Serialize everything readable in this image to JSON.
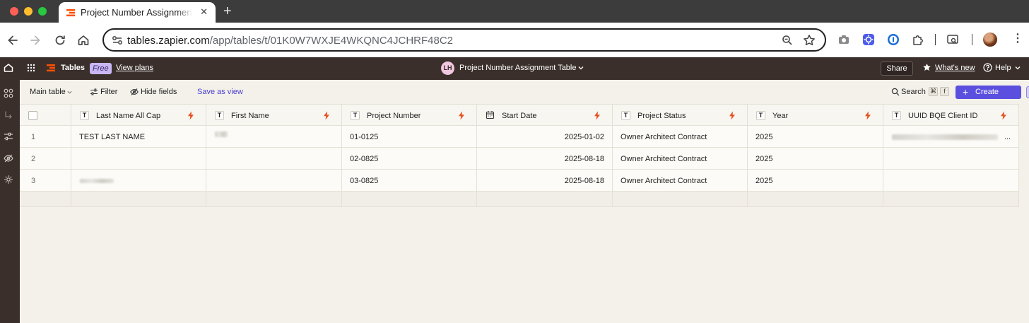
{
  "browser": {
    "tab_title": "Project Number Assignment Table",
    "url_host": "tables.zapier.com",
    "url_path": "/app/tables/t/01K0W7WXJE4WKQNC4JCHRF48C2"
  },
  "app": {
    "brand": "Tables",
    "plan_badge": "Free",
    "view_plans": "View plans",
    "user_initials": "LH",
    "table_title": "Project Number Assignment Table",
    "share": "Share",
    "whats_new": "What's new",
    "help": "Help"
  },
  "viewbar": {
    "view_name": "Main table",
    "filter": "Filter",
    "hide_fields": "Hide fields",
    "save_as_view": "Save as view",
    "search": "Search",
    "shortcut_cmd": "⌘",
    "shortcut_key": "f",
    "create": "Create"
  },
  "table": {
    "columns": [
      {
        "label": "Last Name All Cap",
        "type_icon": "text-type-icon"
      },
      {
        "label": "First Name",
        "type_icon": "text-type-icon"
      },
      {
        "label": "Project Number",
        "type_icon": "text-type-icon"
      },
      {
        "label": "Start Date",
        "type_icon": "date-type-icon"
      },
      {
        "label": "Project Status",
        "type_icon": "text-type-icon"
      },
      {
        "label": "Year",
        "type_icon": "text-type-icon"
      },
      {
        "label": "UUID BQE Client ID",
        "type_icon": "text-type-icon"
      }
    ],
    "rows": [
      {
        "num": "1",
        "last_name": "TEST LAST NAME",
        "first_name": "",
        "project_number": "01-0125",
        "start_date": "2025-01-02",
        "status": "Owner Architect Contract",
        "year": "2025",
        "uuid": "..."
      },
      {
        "num": "2",
        "last_name": "",
        "first_name": "",
        "project_number": "02-0825",
        "start_date": "2025-08-18",
        "status": "Owner Architect Contract",
        "year": "2025",
        "uuid": ""
      },
      {
        "num": "3",
        "last_name": "",
        "first_name": "",
        "project_number": "03-0825",
        "start_date": "2025-08-18",
        "status": "Owner Architect Contract",
        "year": "2025",
        "uuid": ""
      }
    ],
    "type_letter": "T"
  },
  "colors": {
    "accent": "#5b4fe0",
    "header_bg": "#3a2f2b",
    "bolt": "#e8501e",
    "page_bg": "#f4f1ea"
  }
}
